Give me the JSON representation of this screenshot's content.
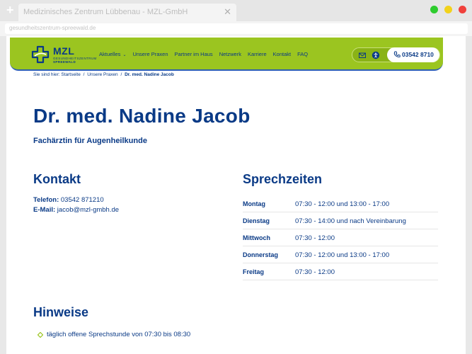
{
  "browser": {
    "tab_title": "Medizinisches Zentrum Lübbenau - MZL-GmbH",
    "tab_close": "✕",
    "new_tab": "+",
    "url": "gesundheitszentrum-spreewald.de"
  },
  "header": {
    "logo": {
      "name": "MZL",
      "sub1": "GESUNDHEITSZENTRUM",
      "sub2": "SPREEWALD"
    },
    "nav": [
      {
        "label": "Aktuelles",
        "has_dropdown": true
      },
      {
        "label": "Unsere Praxen"
      },
      {
        "label": "Partner im Haus"
      },
      {
        "label": "Netzwerk"
      },
      {
        "label": "Karriere"
      },
      {
        "label": "Kontakt"
      },
      {
        "label": "FAQ"
      }
    ],
    "phone": "03542 8710"
  },
  "breadcrumb": {
    "prefix": "Sie sind hier:",
    "items": [
      "Startseite",
      "Unsere Praxen"
    ],
    "current": "Dr. med. Nadine Jacob",
    "separator": "/"
  },
  "main": {
    "title": "Dr. med. Nadine Jacob",
    "subtitle": "Fachärztin für Augenheilkunde",
    "contact": {
      "heading": "Kontakt",
      "phone_label": "Telefon:",
      "phone_value": "03542 871210",
      "email_label": "E-Mail:",
      "email_value": "jacob@mzl-gmbh.de"
    },
    "hours": {
      "heading": "Sprechzeiten",
      "rows": [
        {
          "day": "Montag",
          "time": "07:30 - 12:00 und 13:00 - 17:00"
        },
        {
          "day": "Dienstag",
          "time": "07:30 - 14:00 und nach Vereinbarung"
        },
        {
          "day": "Mittwoch",
          "time": "07:30 - 12:00"
        },
        {
          "day": "Donnerstag",
          "time": "07:30 - 12:00 und 13:00 - 17:00"
        },
        {
          "day": "Freitag",
          "time": "07:30 - 12:00"
        }
      ]
    },
    "notes": {
      "heading": "Hinweise",
      "items": [
        "täglich offene Sprechstunde von 07:30 bis 08:30"
      ]
    }
  },
  "colors": {
    "brand_green": "#9bc520",
    "brand_blue": "#0a3a86"
  }
}
